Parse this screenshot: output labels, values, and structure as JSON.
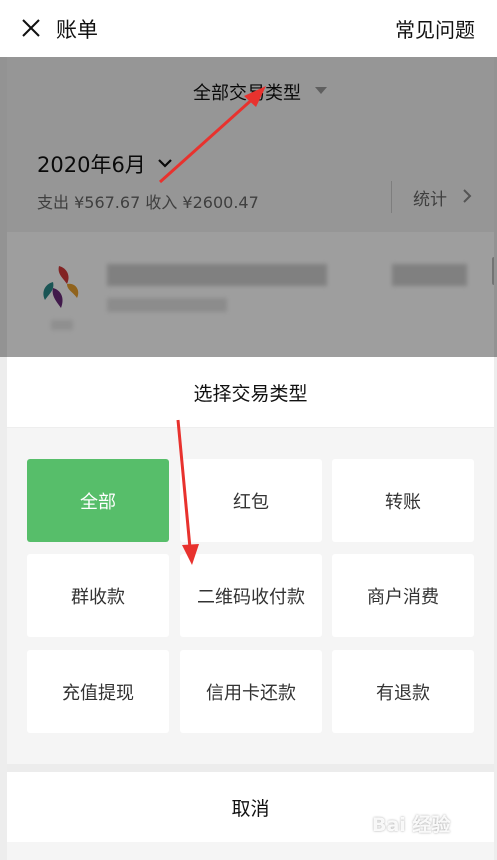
{
  "header": {
    "title": "账单",
    "faq_label": "常见问题"
  },
  "background": {
    "filter_label": "全部交易类型",
    "month": "2020年6月",
    "summary": "支出 ¥567.67 收入 ¥2600.47",
    "stats_label": "统计"
  },
  "sheet": {
    "title": "选择交易类型",
    "options": [
      {
        "label": "全部",
        "selected": true
      },
      {
        "label": "红包",
        "selected": false
      },
      {
        "label": "转账",
        "selected": false
      },
      {
        "label": "群收款",
        "selected": false
      },
      {
        "label": "二维码收付款",
        "selected": false
      },
      {
        "label": "商户消费",
        "selected": false
      },
      {
        "label": "充值提现",
        "selected": false
      },
      {
        "label": "信用卡还款",
        "selected": false
      },
      {
        "label": "有退款",
        "selected": false
      }
    ],
    "cancel_label": "取消"
  },
  "watermark": {
    "text": "Bai 经验"
  },
  "colors": {
    "selected_green": "#57be6a",
    "annotation_red": "#e8322e",
    "overlay": "rgba(0,0,0,0.38)"
  }
}
